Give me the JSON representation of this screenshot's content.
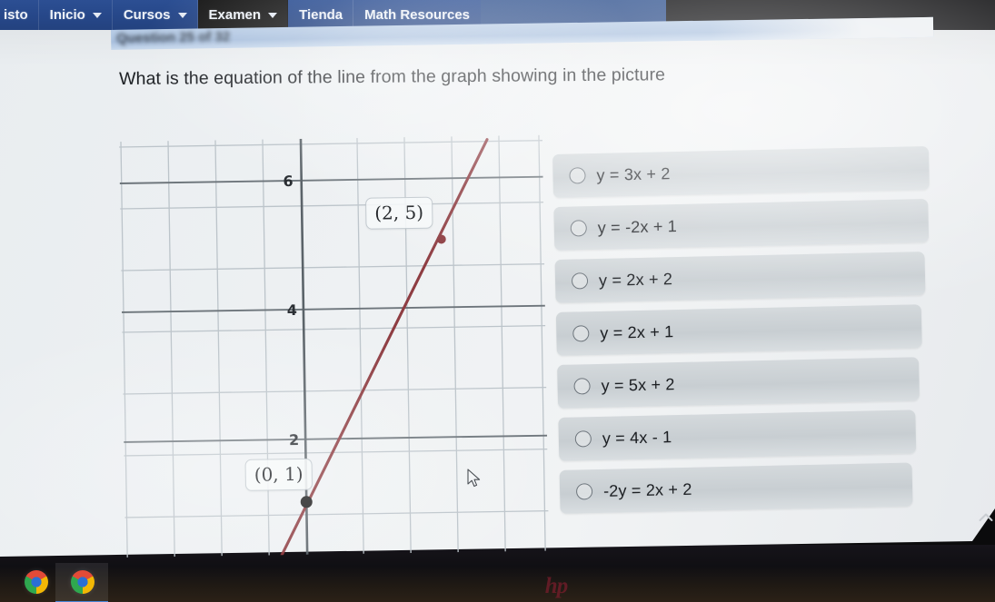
{
  "navbar": {
    "items": [
      {
        "label": "isto",
        "caret": false,
        "active": false,
        "truncated": true
      },
      {
        "label": "Inicio",
        "caret": true,
        "active": false,
        "truncated": false
      },
      {
        "label": "Cursos",
        "caret": true,
        "active": false,
        "truncated": false
      },
      {
        "label": "Examen",
        "caret": true,
        "active": true,
        "truncated": false
      },
      {
        "label": "Tienda",
        "caret": false,
        "active": false,
        "truncated": false
      },
      {
        "label": "Math Resources",
        "caret": false,
        "active": false,
        "truncated": false
      }
    ],
    "background_color": "#27488a",
    "active_background_color": "#181818"
  },
  "question_strip": {
    "text": "Question 25 of 32"
  },
  "prompt": {
    "text": "What is the equation of the line from the graph showing in the picture"
  },
  "options": {
    "items": [
      {
        "label": "y = 3x + 2",
        "selected": false
      },
      {
        "label": "y = -2x + 1",
        "selected": false
      },
      {
        "label": "y = 2x + 2",
        "selected": false
      },
      {
        "label": "y = 2x + 1",
        "selected": false
      },
      {
        "label": "y = 5x + 2",
        "selected": false
      },
      {
        "label": "y = 4x - 1",
        "selected": false
      },
      {
        "label": "-2y = 2x + 2",
        "selected": false
      }
    ]
  },
  "graph": {
    "point_label_a": "(2, 5)",
    "point_label_b": "(0, 1)",
    "axis_labels": [
      {
        "text": "6",
        "value": 6
      },
      {
        "text": "4",
        "value": 4
      },
      {
        "text": "2",
        "value": 2
      }
    ],
    "line_color": "#8e3d42",
    "grid_color": "#b9c2c8",
    "axis_color": "#5e666d"
  },
  "chart_data": {
    "type": "line",
    "title": "",
    "xlabel": "",
    "ylabel": "",
    "grid": true,
    "legend": "none",
    "xlim": [
      -4,
      5
    ],
    "ylim": [
      -1,
      7
    ],
    "yticks": [
      2,
      4,
      6
    ],
    "xticks": [],
    "series": [
      {
        "name": "line",
        "equation": "y = 2x + 1",
        "slope": 2,
        "intercept": 1,
        "color": "#8e3d42",
        "x": [
          -1,
          2.5
        ],
        "y": [
          -1,
          6
        ]
      }
    ],
    "points": [
      {
        "label": "(0, 1)",
        "x": 0,
        "y": 1,
        "marker_color": "#1a1a1a"
      },
      {
        "label": "(2, 5)",
        "x": 2,
        "y": 5,
        "marker_color": "#8e3d42"
      }
    ]
  },
  "taskbar": {
    "icons": [
      {
        "name": "chrome-icon",
        "label": "Google Chrome"
      },
      {
        "name": "chrome-icon",
        "label": "Google Chrome"
      }
    ]
  },
  "device": {
    "brand": "hp"
  }
}
